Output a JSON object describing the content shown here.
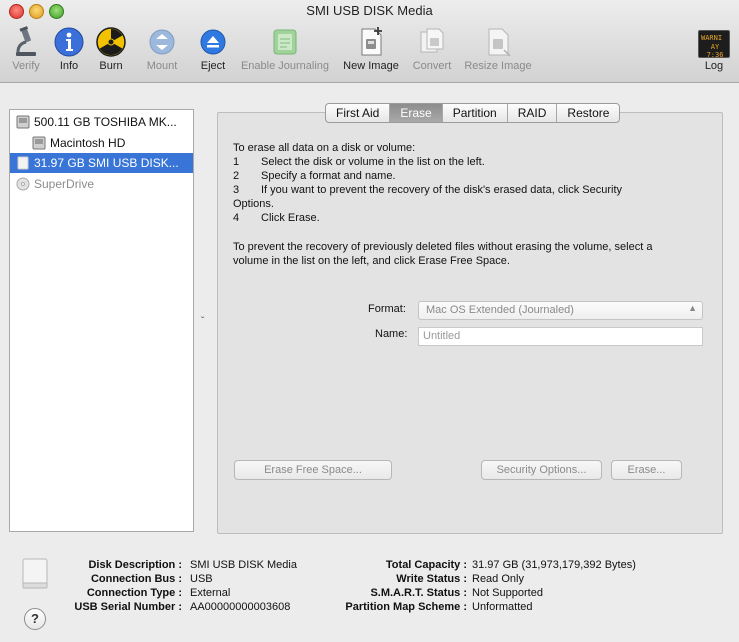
{
  "window": {
    "title": "SMI USB DISK Media"
  },
  "toolbar": {
    "verify": "Verify",
    "info": "Info",
    "burn": "Burn",
    "mount": "Mount",
    "eject": "Eject",
    "enable_journaling": "Enable Journaling",
    "new_image": "New Image",
    "convert": "Convert",
    "resize_image": "Resize Image",
    "log": "Log",
    "log_icon_text_1": "WARNI",
    "log_icon_text_2": "AY 7:36"
  },
  "sidebar": {
    "items": [
      {
        "label": "500.11 GB TOSHIBA MK..."
      },
      {
        "label": "Macintosh HD"
      },
      {
        "label": "31.97 GB SMI USB DISK..."
      },
      {
        "label": "SuperDrive"
      }
    ]
  },
  "tabs": [
    "First Aid",
    "Erase",
    "Partition",
    "RAID",
    "Restore"
  ],
  "erase": {
    "intro": "To erase all data on a disk or volume:",
    "steps": [
      {
        "num": "1",
        "text": "Select the disk or volume in the list on the left."
      },
      {
        "num": "2",
        "text": "Specify a format and name."
      },
      {
        "num": "3",
        "text": "If you want to prevent the recovery of the disk's erased data, click Security"
      },
      {
        "num": "4",
        "text": "Click Erase."
      }
    ],
    "step3_cont": "Options.",
    "free_space_1": "To prevent the recovery of previously deleted files without erasing the volume, select a",
    "free_space_2": "volume in the list on the left, and click Erase Free Space.",
    "format_label": "Format:",
    "format_value": "Mac OS Extended (Journaled)",
    "name_label": "Name:",
    "name_placeholder": "Untitled",
    "erase_free_space_button": "Erase Free Space...",
    "security_options_button": "Security Options...",
    "erase_button": "Erase..."
  },
  "info": {
    "disk_description_label": "Disk Description :",
    "disk_description": "SMI USB DISK Media",
    "connection_bus_label": "Connection Bus :",
    "connection_bus": "USB",
    "connection_type_label": "Connection Type :",
    "connection_type": "External",
    "usb_serial_label": "USB Serial Number :",
    "usb_serial": "AA00000000003608",
    "total_capacity_label": "Total Capacity :",
    "total_capacity": "31.97 GB (31,973,179,392 Bytes)",
    "write_status_label": "Write Status :",
    "write_status": "Read Only",
    "smart_status_label": "S.M.A.R.T. Status :",
    "smart_status": "Not Supported",
    "partition_map_label": "Partition Map Scheme :",
    "partition_map": "Unformatted"
  },
  "help": "?"
}
